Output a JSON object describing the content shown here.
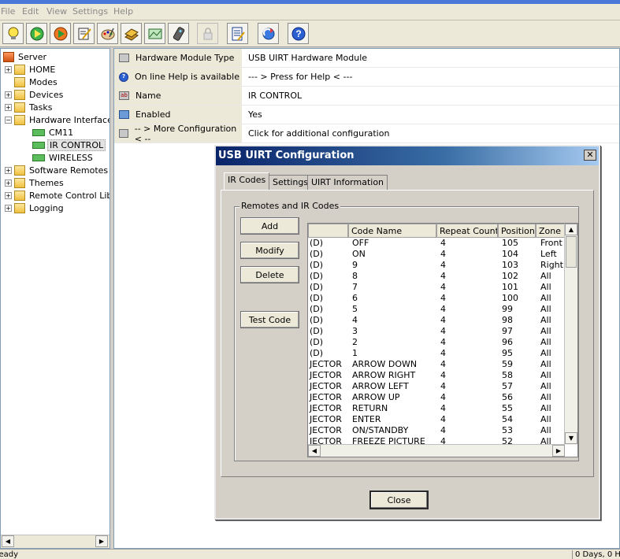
{
  "menu": [
    "File",
    "Edit",
    "View",
    "Settings",
    "Help"
  ],
  "toolbar": [
    "bulb-icon",
    "play-green-icon",
    "play-orange-icon",
    "edit-icon",
    "paint-icon",
    "book-icon",
    "picture-icon",
    "remote-icon",
    "lock-icon",
    "list-icon",
    "refresh-icon",
    "help-icon"
  ],
  "tree": {
    "root": "Server",
    "items": [
      {
        "label": "HOME"
      },
      {
        "label": "Modes"
      },
      {
        "label": "Devices"
      },
      {
        "label": "Tasks"
      },
      {
        "label": "Hardware Interface"
      },
      {
        "label": "CM11"
      },
      {
        "label": "IR CONTROL"
      },
      {
        "label": "WIRELESS"
      },
      {
        "label": "Software Remotes"
      },
      {
        "label": "Themes"
      },
      {
        "label": "Remote Control Libr"
      },
      {
        "label": "Logging"
      }
    ]
  },
  "properties": [
    {
      "name": "Hardware Module Type",
      "value": "USB UIRT Hardware Module"
    },
    {
      "name": "On line Help is available",
      "value": "--- > Press for Help < ---"
    },
    {
      "name": "Name",
      "value": "IR CONTROL"
    },
    {
      "name": "Enabled",
      "value": "Yes"
    },
    {
      "name": "-- > More Configuration < --",
      "value": "Click for additional configuration"
    }
  ],
  "status": {
    "left": "Ready",
    "right": "0 Days, 0 Ho"
  },
  "dialog": {
    "title": "USB UIRT Configuration",
    "close_glyph": "✕",
    "tabs": [
      "IR Codes",
      "Settings",
      "UIRT Information"
    ],
    "group_label": "Remotes and IR Codes",
    "buttons": {
      "add": "Add",
      "modify": "Modify",
      "delete": "Delete",
      "test": "Test Code"
    },
    "close_button": "Close",
    "columns": [
      "",
      "Code Name",
      "Repeat Count",
      "Position",
      "Zone"
    ],
    "rows": [
      [
        "(D)",
        "OFF",
        "4",
        "105",
        "Front"
      ],
      [
        "(D)",
        "ON",
        "4",
        "104",
        "Left"
      ],
      [
        "(D)",
        "9",
        "4",
        "103",
        "Right"
      ],
      [
        "(D)",
        "8",
        "4",
        "102",
        "All"
      ],
      [
        "(D)",
        "7",
        "4",
        "101",
        "All"
      ],
      [
        "(D)",
        "6",
        "4",
        "100",
        "All"
      ],
      [
        "(D)",
        "5",
        "4",
        "99",
        "All"
      ],
      [
        "(D)",
        "4",
        "4",
        "98",
        "All"
      ],
      [
        "(D)",
        "3",
        "4",
        "97",
        "All"
      ],
      [
        "(D)",
        "2",
        "4",
        "96",
        "All"
      ],
      [
        "(D)",
        "1",
        "4",
        "95",
        "All"
      ],
      [
        "JECTOR",
        "ARROW DOWN",
        "4",
        "59",
        "All"
      ],
      [
        "JECTOR",
        "ARROW RIGHT",
        "4",
        "58",
        "All"
      ],
      [
        "JECTOR",
        "ARROW LEFT",
        "4",
        "57",
        "All"
      ],
      [
        "JECTOR",
        "ARROW UP",
        "4",
        "56",
        "All"
      ],
      [
        "JECTOR",
        "RETURN",
        "4",
        "55",
        "All"
      ],
      [
        "JECTOR",
        "ENTER",
        "4",
        "54",
        "All"
      ],
      [
        "JECTOR",
        "ON/STANDBY",
        "4",
        "53",
        "All"
      ],
      [
        "JECTOR",
        "FREEZE PICTURE",
        "4",
        "52",
        "All"
      ]
    ]
  }
}
